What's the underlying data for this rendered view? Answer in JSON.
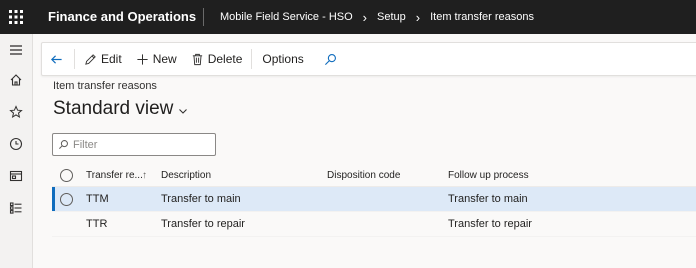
{
  "app": {
    "name": "Finance and Operations"
  },
  "breadcrumbs": [
    "Mobile Field Service - HSO",
    "Setup",
    "Item transfer reasons"
  ],
  "toolbar": {
    "edit": "Edit",
    "new": "New",
    "delete": "Delete",
    "options": "Options"
  },
  "page": {
    "label": "Item transfer reasons",
    "view_name": "Standard view"
  },
  "filter": {
    "placeholder": "Filter",
    "value": ""
  },
  "grid": {
    "columns": [
      "Transfer re...",
      "Description",
      "Disposition code",
      "Follow up process"
    ],
    "sort_indicator": "↑",
    "rows": [
      {
        "code": "TTM",
        "description": "Transfer to main",
        "disposition": "",
        "followup": "Transfer to main"
      },
      {
        "code": "TTR",
        "description": "Transfer to repair",
        "disposition": "",
        "followup": "Transfer to repair"
      }
    ]
  },
  "colors": {
    "topbar": "#1f1f1f",
    "accent": "#0f6cbd",
    "selected_row": "#dde9f7"
  }
}
